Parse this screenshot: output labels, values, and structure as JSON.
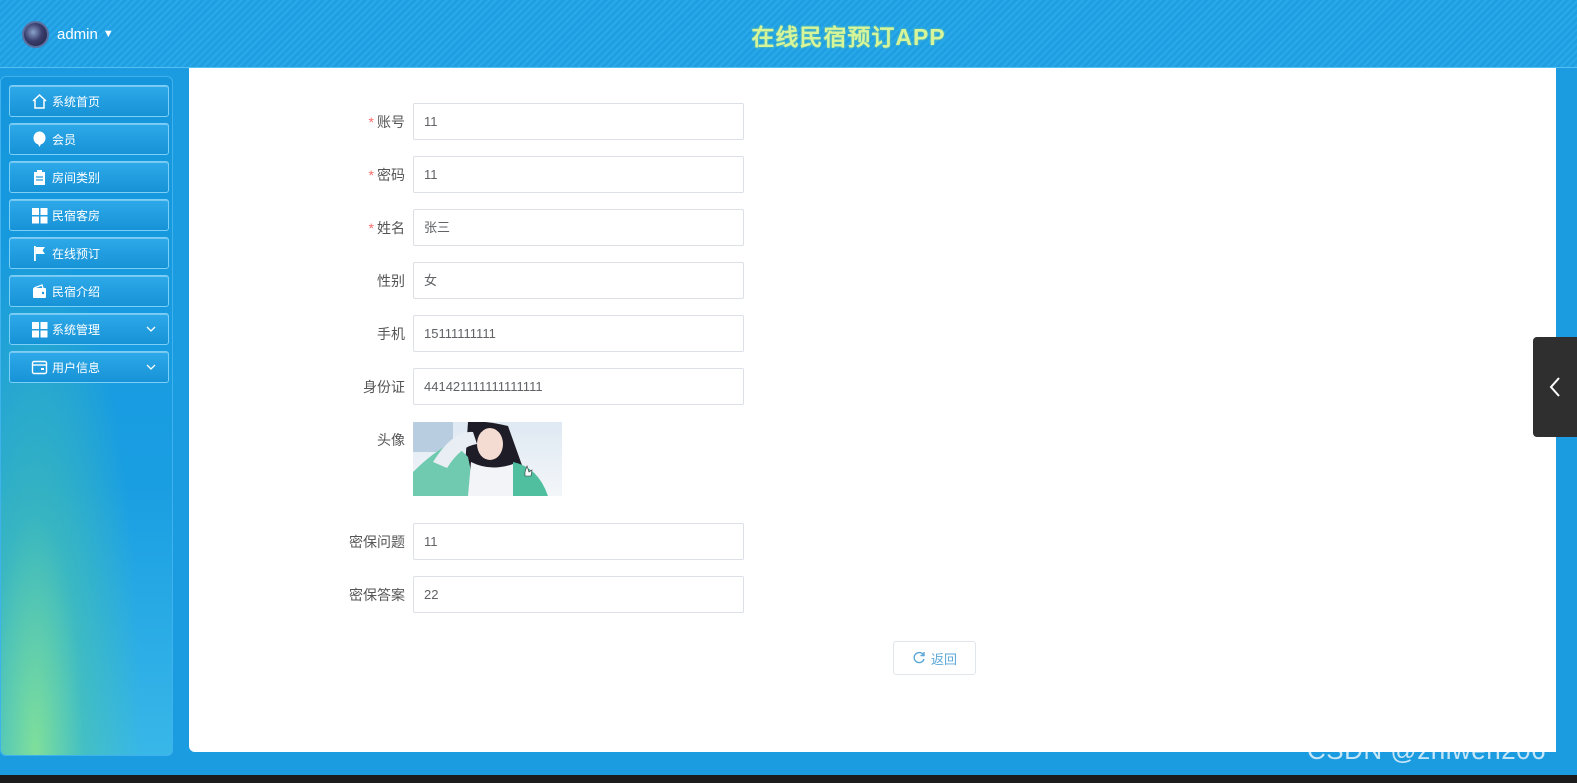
{
  "header": {
    "username": "admin",
    "title": "在线民宿预订APP"
  },
  "sidebar": {
    "items": [
      {
        "label": "系统首页",
        "icon": "home-icon"
      },
      {
        "label": "会员",
        "icon": "balloon-icon"
      },
      {
        "label": "房间类别",
        "icon": "clipboard-icon"
      },
      {
        "label": "民宿客房",
        "icon": "grid-icon"
      },
      {
        "label": "在线预订",
        "icon": "flag-icon"
      },
      {
        "label": "民宿介绍",
        "icon": "wallet-icon"
      },
      {
        "label": "系统管理",
        "icon": "grid-icon",
        "expandable": true
      },
      {
        "label": "用户信息",
        "icon": "card-icon",
        "expandable": true
      }
    ]
  },
  "form": {
    "fields": [
      {
        "label": "账号",
        "required": true,
        "value": "11"
      },
      {
        "label": "密码",
        "required": true,
        "value": "11"
      },
      {
        "label": "姓名",
        "required": true,
        "value": "张三"
      },
      {
        "label": "性别",
        "required": false,
        "value": "女"
      },
      {
        "label": "手机",
        "required": false,
        "value": "15111111111"
      },
      {
        "label": "身份证",
        "required": false,
        "value": "441421111111111111"
      }
    ],
    "avatar_label": "头像",
    "extra_fields": [
      {
        "label": "密保问题",
        "value": "11"
      },
      {
        "label": "密保答案",
        "value": "22"
      }
    ],
    "required_mark": "*",
    "back_button": "返回"
  },
  "watermark": "CSDN @zhiwen206",
  "colors": {
    "accent": "#1b9be0",
    "required": "#f56c6c",
    "button_text": "#5ba7d8"
  }
}
